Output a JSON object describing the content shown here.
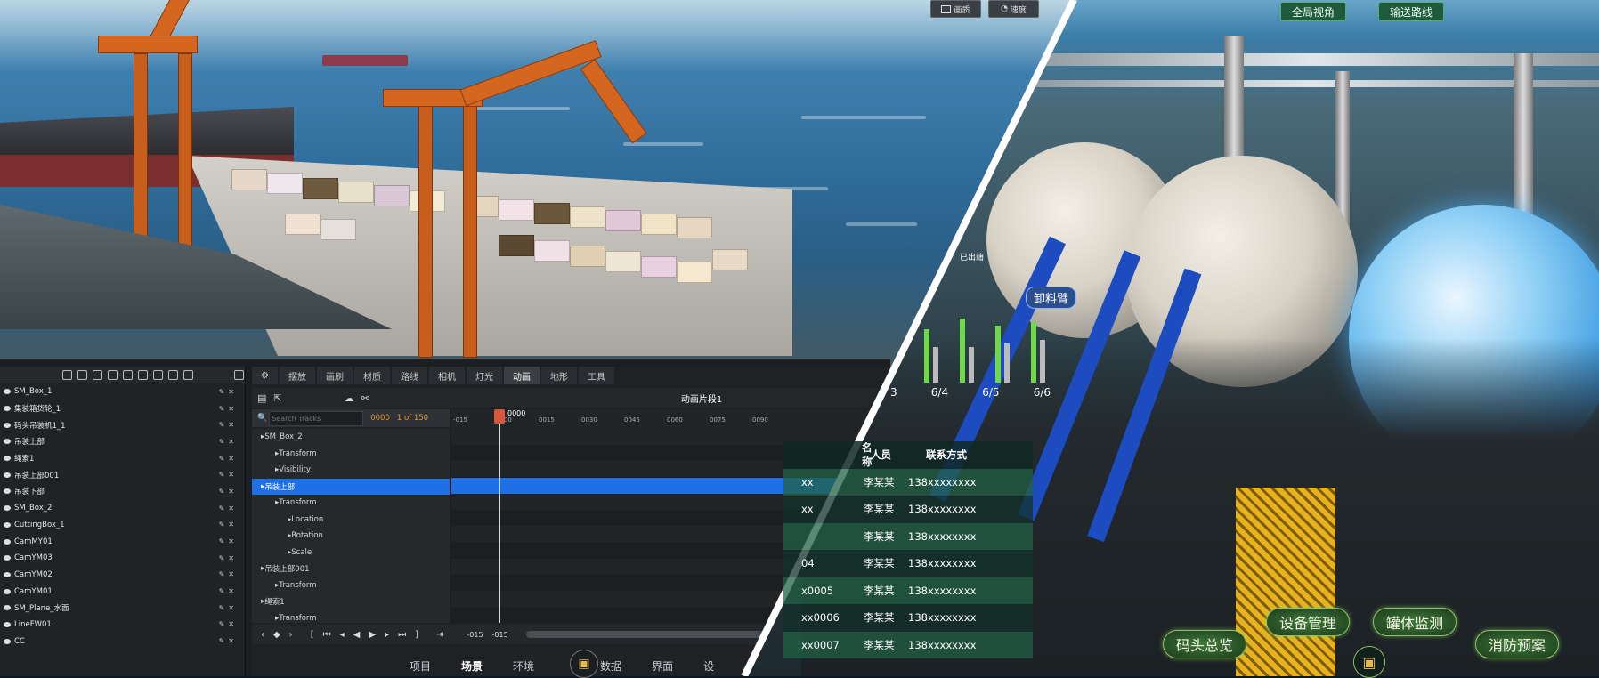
{
  "left_view": {
    "top_buttons": [
      "画质",
      "速度"
    ],
    "outliner": {
      "search_placeholder": "",
      "items": [
        "SM_Box_1",
        "集装箱货轮_1",
        "码头吊装机1_1",
        "吊装上部",
        "绳索1",
        "吊装上部001",
        "吊装下部",
        "SM_Box_2",
        "CuttingBox_1",
        "CamMY01",
        "CamYM03",
        "CamYM02",
        "CamYM01",
        "SM_Plane_水面",
        "LineFW01",
        "CC"
      ]
    },
    "sequencer": {
      "tabs": [
        "摆放",
        "画刷",
        "材质",
        "路线",
        "相机",
        "灯光",
        "动画",
        "地形",
        "工具"
      ],
      "active_tab": "动画",
      "clip_title": "动画片段1",
      "search_placeholder": "Search Tracks",
      "frame_current": "0000",
      "frame_count": "1 of 150",
      "ruler": [
        "-015",
        "0000",
        "0015",
        "0030",
        "0045",
        "0060",
        "0075",
        "0090"
      ],
      "playhead_label": "0000",
      "tracks": [
        {
          "label": "SM_Box_2",
          "level": 0
        },
        {
          "label": "Transform",
          "level": 1
        },
        {
          "label": "Visibility",
          "level": 1
        },
        {
          "label": "吊装上部",
          "level": 0,
          "selected": true
        },
        {
          "label": "Transform",
          "level": 1
        },
        {
          "label": "Location",
          "level": 2
        },
        {
          "label": "Rotation",
          "level": 2
        },
        {
          "label": "Scale",
          "level": 2
        },
        {
          "label": "吊装上部001",
          "level": 0
        },
        {
          "label": "Transform",
          "level": 1
        },
        {
          "label": "绳索1",
          "level": 0
        },
        {
          "label": "Transform",
          "level": 1
        }
      ],
      "bottom_range": [
        "-015",
        "-015"
      ]
    },
    "bottom_nav": [
      "项目",
      "场景",
      "环境",
      "数据",
      "界面",
      "设"
    ]
  },
  "right_view": {
    "top_tags": [
      "全局视角",
      "输送路线"
    ],
    "labels": {
      "unload_arm": "卸料臂",
      "exited": "已出籍"
    },
    "chart_dates": [
      "3",
      "6/4",
      "6/5",
      "6/6"
    ],
    "table": {
      "headers": [
        "名称",
        "人员",
        "联系方式"
      ],
      "rows": [
        [
          "xx",
          "李某某",
          "138xxxxxxxx"
        ],
        [
          "xx",
          "李某某",
          "138xxxxxxxx"
        ],
        [
          "",
          "李某某",
          "138xxxxxxxx"
        ],
        [
          "04",
          "李某某",
          "138xxxxxxxx"
        ],
        [
          "x0005",
          "李某某",
          "138xxxxxxxx"
        ],
        [
          "xx0006",
          "李某某",
          "138xxxxxxxx"
        ],
        [
          "xx0007",
          "李某某",
          "138xxxxxxxx"
        ]
      ]
    },
    "nav_buttons": [
      "码头总览",
      "设备管理",
      "罐体监测",
      "消防预案"
    ]
  }
}
